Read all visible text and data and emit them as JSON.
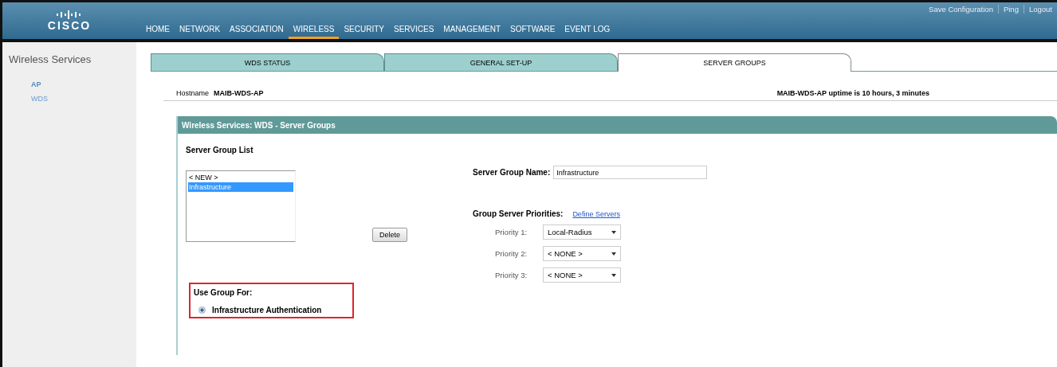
{
  "header": {
    "logo": "CISCO",
    "nav": [
      {
        "label": "HOME",
        "selected": false
      },
      {
        "label": "NETWORK",
        "selected": false
      },
      {
        "label": "ASSOCIATION",
        "selected": false
      },
      {
        "label": "WIRELESS",
        "selected": true
      },
      {
        "label": "SECURITY",
        "selected": false
      },
      {
        "label": "SERVICES",
        "selected": false
      },
      {
        "label": "MANAGEMENT",
        "selected": false
      },
      {
        "label": "SOFTWARE",
        "selected": false
      },
      {
        "label": "EVENT LOG",
        "selected": false
      }
    ],
    "links": [
      "Save Configuration",
      "Ping",
      "Logout"
    ]
  },
  "sidebar": {
    "title": "Wireless Services",
    "items": [
      {
        "label": "AP",
        "selected": true
      },
      {
        "label": "WDS",
        "selected": false
      }
    ]
  },
  "tabs": [
    {
      "label": "WDS STATUS",
      "selected": false
    },
    {
      "label": "GENERAL SET-UP",
      "selected": false
    },
    {
      "label": "SERVER GROUPS",
      "selected": true
    }
  ],
  "hostname": {
    "label": "Hostname",
    "value": "MAIB-WDS-AP",
    "uptime": "MAIB-WDS-AP uptime is 10 hours, 3 minutes"
  },
  "panel": {
    "title": "Wireless Services: WDS - Server Groups",
    "list_title": "Server Group List",
    "list": [
      {
        "label": "< NEW >",
        "selected": false
      },
      {
        "label": "Infrastructure",
        "selected": true
      }
    ],
    "delete_button": "Delete",
    "name_label": "Server Group Name:",
    "name_value": "Infrastructure",
    "priorities_label": "Group Server Priorities:",
    "define_link": "Define Servers",
    "priorities": [
      {
        "label": "Priority 1:",
        "value": "Local-Radius"
      },
      {
        "label": "Priority 2:",
        "value": "< NONE >"
      },
      {
        "label": "Priority 3:",
        "value": "< NONE >"
      }
    ],
    "use_for": {
      "label": "Use Group For:",
      "highlighted": true,
      "options": [
        {
          "label": "Infrastructure Authentication",
          "selected": true
        }
      ]
    }
  }
}
